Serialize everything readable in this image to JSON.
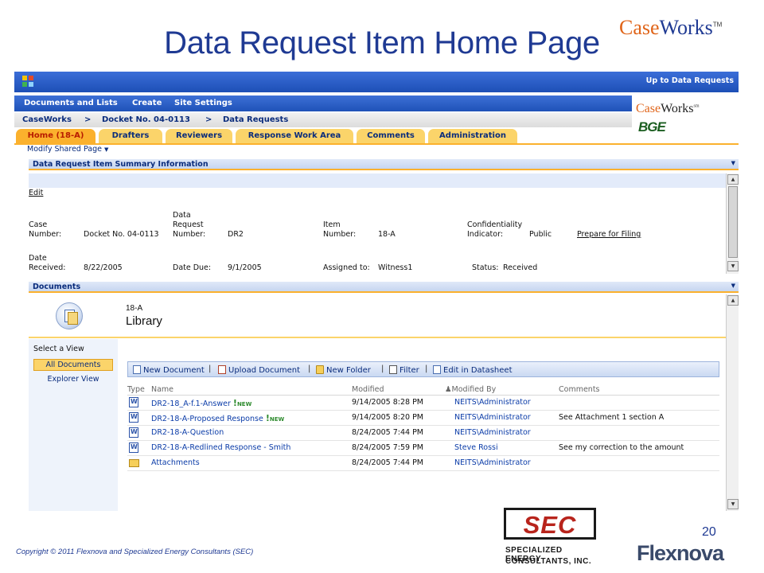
{
  "slide": {
    "title": "Data Request Item Home Page",
    "brand": {
      "part1": "Case",
      "part2": "Works",
      "tm": "TM"
    },
    "page_number": "20",
    "copyright": "Copyright © 2011 Flexnova and Specialized Energy Consultants (SEC)",
    "sec_logo": {
      "mark": "SEC",
      "line1": "SPECIALIZED ENERGY",
      "line2": "CONSULTANTS, INC."
    },
    "flexnova_logo": "Flexnova"
  },
  "app": {
    "top_link": "Up to Data Requests",
    "menu": [
      "Documents and Lists",
      "Create",
      "Site Settings"
    ],
    "breadcrumb": [
      "CaseWorks",
      ">",
      "Docket No. 04-0113",
      ">",
      "Data Requests"
    ],
    "brandbox": {
      "part1": "Case",
      "part2": "Works",
      "sm": "sm",
      "bge": "BGE"
    },
    "tabs": [
      "Home (18-A)",
      "Drafters",
      "Reviewers",
      "Response Work Area",
      "Comments",
      "Administration"
    ],
    "modify_label": "Modify Shared Page",
    "summary": {
      "header": "Data Request Item Summary Information",
      "edit": "Edit",
      "case_label": "Case\nNumber:",
      "case_value": "Docket No. 04-0113",
      "dr_label": "Data\nRequest\nNumber:",
      "dr_value": "DR2",
      "item_label": "Item\nNumber:",
      "item_value": "18-A",
      "conf_label": "Confidentiality\nIndicator:",
      "conf_value": "Public",
      "prepare_link": "Prepare for Filing",
      "date_rec_label": "Date\nReceived:",
      "date_rec_value": "8/22/2005",
      "date_due_label": "Date Due:",
      "date_due_value": "9/1/2005",
      "assigned_label": "Assigned to:",
      "assigned_value": "Witness1",
      "status_label": "Status:",
      "status_value": "Received"
    },
    "documents": {
      "header": "Documents",
      "library_code": "18-A",
      "library_name": "Library",
      "select_view": "Select a View",
      "views": [
        "All Documents",
        "Explorer View"
      ],
      "toolbar": {
        "new_doc": "New Document",
        "upload": "Upload Document",
        "new_folder": "New Folder",
        "filter": "Filter",
        "datasheet": "Edit in Datasheet",
        "sep": "|"
      },
      "columns": [
        "Type",
        "Name",
        "Modified",
        "Modified By",
        "Comments"
      ],
      "new_badge": "NEW",
      "rows": [
        {
          "name": "DR2-18_A-f.1-Answer",
          "modified": "9/14/2005 8:28 PM",
          "by": "NEITS\\Administrator",
          "comments": ""
        },
        {
          "name": "DR2-18-A-Proposed Response",
          "modified": "9/14/2005 8:20 PM",
          "by": "NEITS\\Administrator",
          "comments": "See Attachment 1 section A"
        },
        {
          "name": "DR2-18-A-Question",
          "modified": "8/24/2005 7:44 PM",
          "by": "NEITS\\Administrator",
          "comments": ""
        },
        {
          "name": "DR2-18-A-Redlined Response - Smith",
          "modified": "8/24/2005 7:59 PM",
          "by": "Steve Rossi",
          "comments": "See my correction to the amount"
        },
        {
          "name": "Attachments",
          "modified": "8/24/2005 7:44 PM",
          "by": "NEITS\\Administrator",
          "comments": ""
        }
      ]
    }
  }
}
